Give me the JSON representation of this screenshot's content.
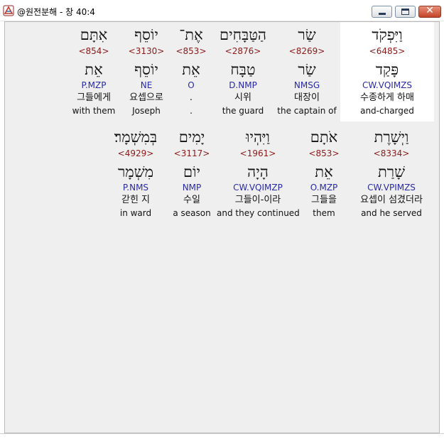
{
  "window": {
    "title": "@원전분해 - 창 40:4",
    "close_glyph": "✕"
  },
  "colors": {
    "strong_number": "#8b1a1a",
    "morphology": "#2a2aa8",
    "selected_background": "#ffffff"
  },
  "rows": [
    [
      {
        "hebrew": "וַיִּפְקֹד",
        "strong": "<6485>",
        "lemma": "פָּקַד",
        "morph": "CW.VQIMZS",
        "korean": "수종하게 하매",
        "english": "and-charged",
        "selected": true
      },
      {
        "hebrew": "שַׂר",
        "strong": "<8269>",
        "lemma": "שַׂר",
        "morph": "NMSG",
        "korean": "대장이",
        "english": "the captain of"
      },
      {
        "hebrew": "הַטַּבָּחִים",
        "strong": "<2876>",
        "lemma": "טַבָּח",
        "morph": "D.NMP",
        "korean": "시위",
        "english": "the guard"
      },
      {
        "hebrew": "אֶת־",
        "strong": "<853>",
        "lemma": "אֵת",
        "morph": "O",
        "korean": ".",
        "english": "."
      },
      {
        "hebrew": "יוֹסֵף",
        "strong": "<3130>",
        "lemma": "יוֹסֵף",
        "morph": "NE",
        "korean": "요셉으로",
        "english": "Joseph"
      },
      {
        "hebrew": "אִתָּם",
        "strong": "<854>",
        "lemma": "אֵת",
        "morph": "P.MZP",
        "korean": "그들에게",
        "english": "with them"
      }
    ],
    [
      {
        "hebrew": "וַיְשָׁרֶת",
        "strong": "<8334>",
        "lemma": "שָׁרַת",
        "morph": "CW.VPIMZS",
        "korean": "요셉이 섬겼더라",
        "english": "and he served"
      },
      {
        "hebrew": "אֹתָם",
        "strong": "<853>",
        "lemma": "אֵת",
        "morph": "O.MZP",
        "korean": "그들을",
        "english": "them"
      },
      {
        "hebrew": "וַיִּהְיוּ",
        "strong": "<1961>",
        "lemma": "הָיָה",
        "morph": "CW.VQIMZP",
        "korean": "그들이-이라",
        "english": "and they continued"
      },
      {
        "hebrew": "יָמִים",
        "strong": "<3117>",
        "lemma": "יוֹם",
        "morph": "NMP",
        "korean": "수일",
        "english": "a season"
      },
      {
        "hebrew": "בְּמִשְׁמָר׃",
        "strong": "<4929>",
        "lemma": "מִשְׁמָר",
        "morph": "P.NMS",
        "korean": "갇힌 지",
        "english": "in ward"
      }
    ]
  ]
}
